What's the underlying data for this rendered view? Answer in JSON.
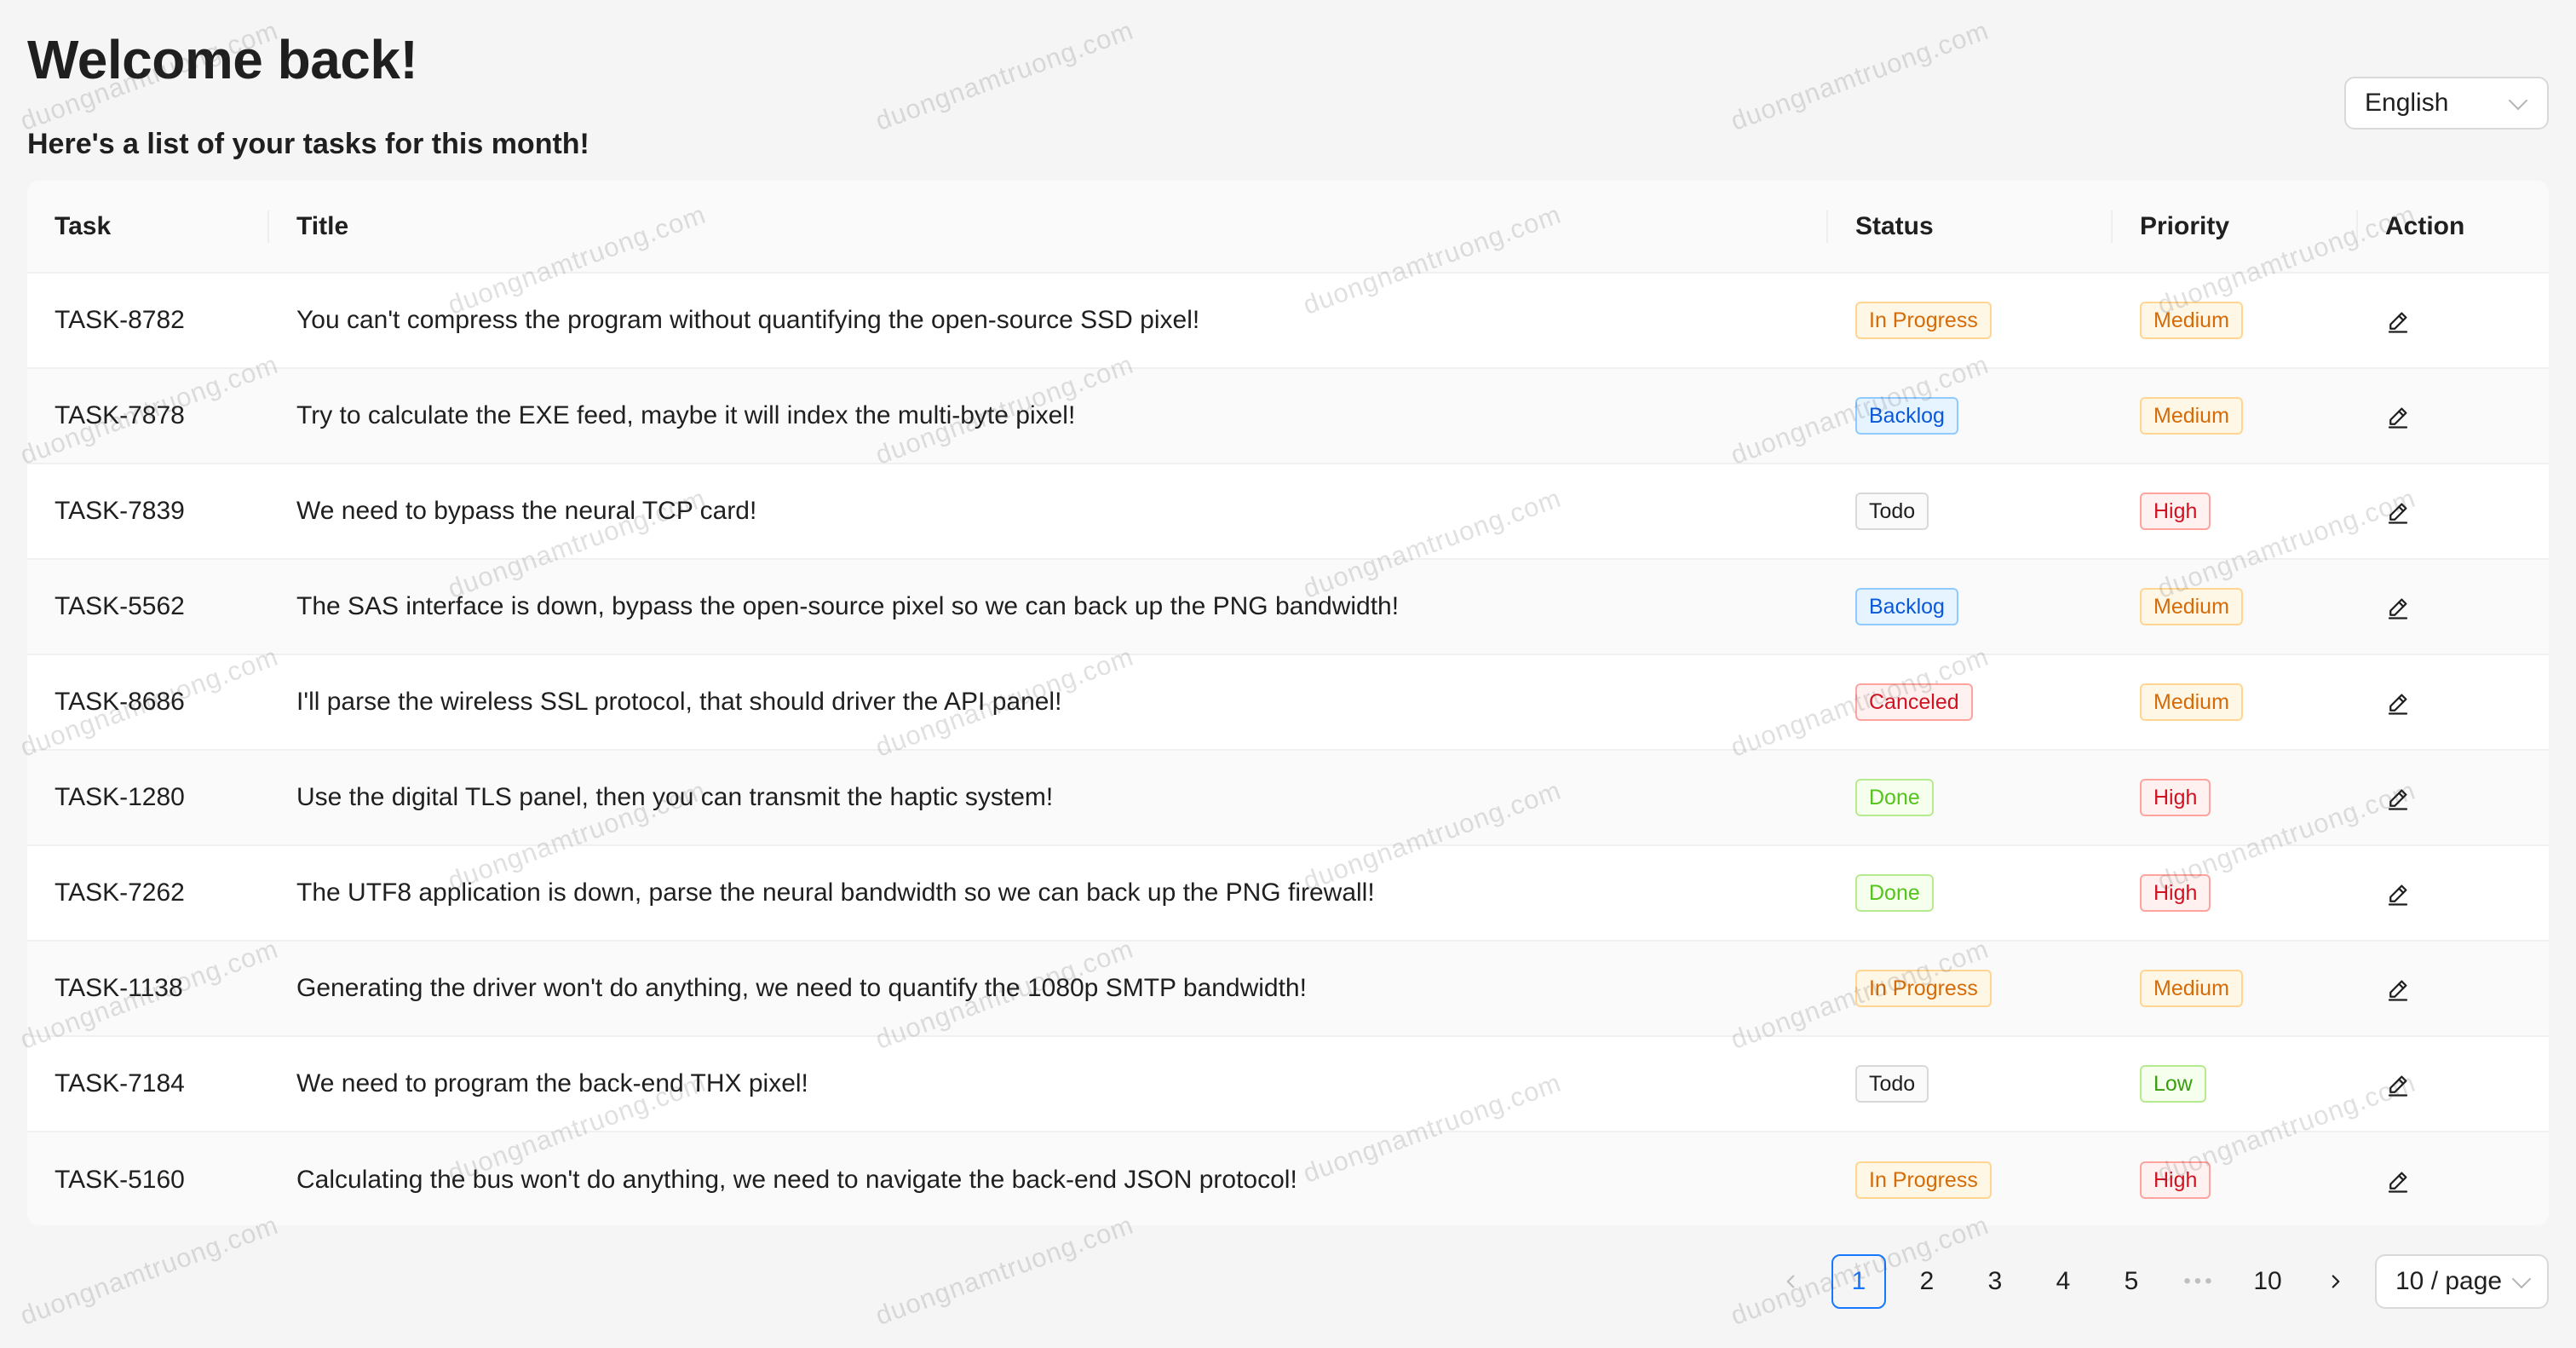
{
  "header": {
    "title": "Welcome back!",
    "subtitle": "Here's a list of your tasks for this month!"
  },
  "language_select": {
    "value": "English",
    "icon": "chevron-down-icon"
  },
  "table": {
    "columns": [
      "Task",
      "Title",
      "Status",
      "Priority",
      "Action"
    ],
    "rows": [
      {
        "id": "TASK-8782",
        "title": "You can't compress the program without quantifying the open-source SSD pixel!",
        "status": "In Progress",
        "priority": "Medium"
      },
      {
        "id": "TASK-7878",
        "title": "Try to calculate the EXE feed, maybe it will index the multi-byte pixel!",
        "status": "Backlog",
        "priority": "Medium"
      },
      {
        "id": "TASK-7839",
        "title": "We need to bypass the neural TCP card!",
        "status": "Todo",
        "priority": "High"
      },
      {
        "id": "TASK-5562",
        "title": "The SAS interface is down, bypass the open-source pixel so we can back up the PNG bandwidth!",
        "status": "Backlog",
        "priority": "Medium"
      },
      {
        "id": "TASK-8686",
        "title": "I'll parse the wireless SSL protocol, that should driver the API panel!",
        "status": "Canceled",
        "priority": "Medium"
      },
      {
        "id": "TASK-1280",
        "title": "Use the digital TLS panel, then you can transmit the haptic system!",
        "status": "Done",
        "priority": "High"
      },
      {
        "id": "TASK-7262",
        "title": "The UTF8 application is down, parse the neural bandwidth so we can back up the PNG firewall!",
        "status": "Done",
        "priority": "High"
      },
      {
        "id": "TASK-1138",
        "title": "Generating the driver won't do anything, we need to quantify the 1080p SMTP bandwidth!",
        "status": "In Progress",
        "priority": "Medium"
      },
      {
        "id": "TASK-7184",
        "title": "We need to program the back-end THX pixel!",
        "status": "Todo",
        "priority": "Low"
      },
      {
        "id": "TASK-5160",
        "title": "Calculating the bus won't do anything, we need to navigate the back-end JSON protocol!",
        "status": "In Progress",
        "priority": "High"
      }
    ],
    "action_icon": "edit-icon"
  },
  "status_colors": {
    "In Progress": {
      "fg": "#d46b08",
      "bg": "#fff7e6",
      "border": "#ffd591"
    },
    "Backlog": {
      "fg": "#0958d9",
      "bg": "#e6f4ff",
      "border": "#91caff"
    },
    "Todo": {
      "fg": "#1f1f1f",
      "bg": "#fafafa",
      "border": "#d9d9d9"
    },
    "Canceled": {
      "fg": "#cf1322",
      "bg": "#fff1f0",
      "border": "#ffa39e"
    },
    "Done": {
      "fg": "#52c41a",
      "bg": "#f6ffed",
      "border": "#b7eb8f"
    }
  },
  "priority_colors": {
    "Medium": {
      "fg": "#d46b08",
      "bg": "#fff7e6",
      "border": "#ffd591"
    },
    "High": {
      "fg": "#cf1322",
      "bg": "#fff1f0",
      "border": "#ffa39e"
    },
    "Low": {
      "fg": "#389e0d",
      "bg": "#f6ffed",
      "border": "#b7eb8f"
    }
  },
  "pagination": {
    "pages": [
      "1",
      "2",
      "3",
      "4",
      "5",
      "•••",
      "10"
    ],
    "current": "1",
    "prev_icon": "chevron-left-icon",
    "next_icon": "chevron-right-icon",
    "page_size": "10 / page"
  },
  "watermark": {
    "text": "duongnamtruong.com"
  }
}
